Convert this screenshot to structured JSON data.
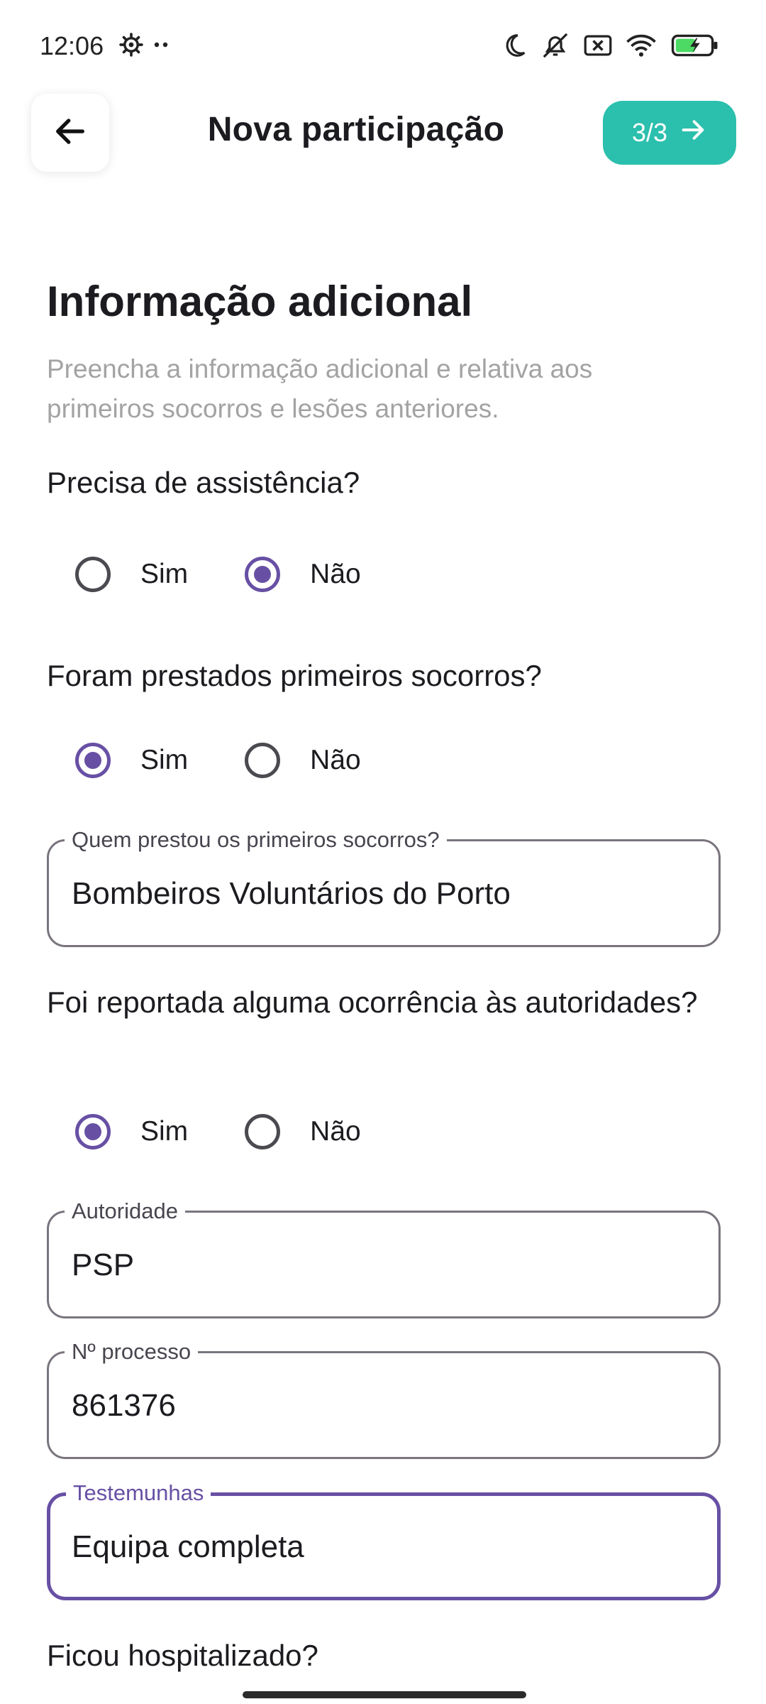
{
  "status_bar": {
    "time": "12:06",
    "left_icons": [
      "gear-icon",
      "more-dots-icon"
    ],
    "right_icons": [
      "moon-icon",
      "mute-icon",
      "sim-off-icon",
      "wifi-icon",
      "battery-charging-icon"
    ]
  },
  "app_bar": {
    "title": "Nova participação",
    "step_label": "3/3",
    "accent_color": "#2bbfad"
  },
  "form": {
    "title": "Informação adicional",
    "subtitle": "Preencha a informação adicional e relativa aos primeiros socorros e lesões anteriores.",
    "assistance": {
      "question": "Precisa de assistência?",
      "options": [
        "Sim",
        "Não"
      ],
      "selected": "Não"
    },
    "first_aid": {
      "question": "Foram prestados primeiros socorros?",
      "options": [
        "Sim",
        "Não"
      ],
      "selected": "Sim",
      "provider_label": "Quem prestou os primeiros socorros?",
      "provider_value": "Bombeiros Voluntários do Porto"
    },
    "authorities": {
      "question": "Foi reportada alguma ocorrência às autoridades?",
      "options": [
        "Sim",
        "Não"
      ],
      "selected": "Sim",
      "authority_label": "Autoridade",
      "authority_value": "PSP",
      "process_label": "Nº processo",
      "process_value": "861376",
      "witnesses_label": "Testemunhas",
      "witnesses_value": "Equipa completa"
    },
    "hospitalized": {
      "question": "Ficou hospitalizado?"
    }
  },
  "colors": {
    "primary": "#6750a4",
    "outline": "#79747e",
    "subtitle": "#a3a3a3"
  }
}
